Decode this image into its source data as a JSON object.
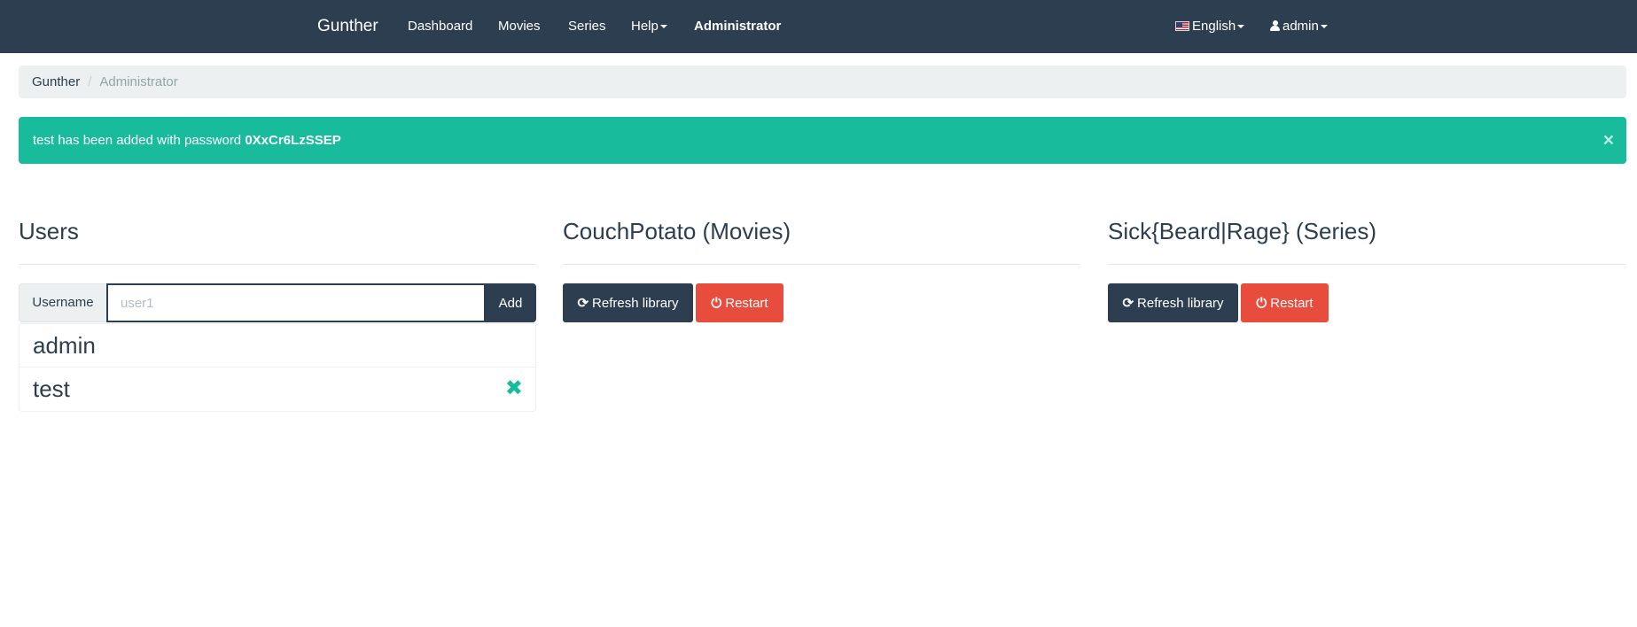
{
  "navbar": {
    "brand": "Gunther",
    "links": [
      "Dashboard",
      "Movies",
      "Series",
      "Help",
      "Administrator"
    ],
    "language": "English",
    "user": "admin"
  },
  "breadcrumb": {
    "home": "Gunther",
    "separator": "/",
    "current": "Administrator"
  },
  "alert": {
    "message": "test has been added with password ",
    "password": "0XxCr6LzSSEP",
    "close": "×"
  },
  "users_panel": {
    "title": "Users",
    "input_label": "Username",
    "input_placeholder": "user1",
    "input_value": "",
    "add_label": "Add",
    "users": [
      {
        "name": "admin",
        "removable": false
      },
      {
        "name": "test",
        "removable": true
      }
    ]
  },
  "couchpotato_panel": {
    "title": "CouchPotato (Movies)",
    "refresh_label": "Refresh library",
    "restart_label": "Restart"
  },
  "sickbeard_panel": {
    "title": "Sick{Beard|Rage} (Series)",
    "refresh_label": "Refresh library",
    "restart_label": "Restart"
  },
  "icons": {
    "remove": "remove-icon",
    "refresh": "refresh-icon",
    "power": "power-icon",
    "flag": "us-flag-icon",
    "user": "user-icon"
  },
  "colors": {
    "navbar": "#2c3e50",
    "success": "#18bc9c",
    "danger": "#e74c3c",
    "light": "#ecf0f1"
  }
}
